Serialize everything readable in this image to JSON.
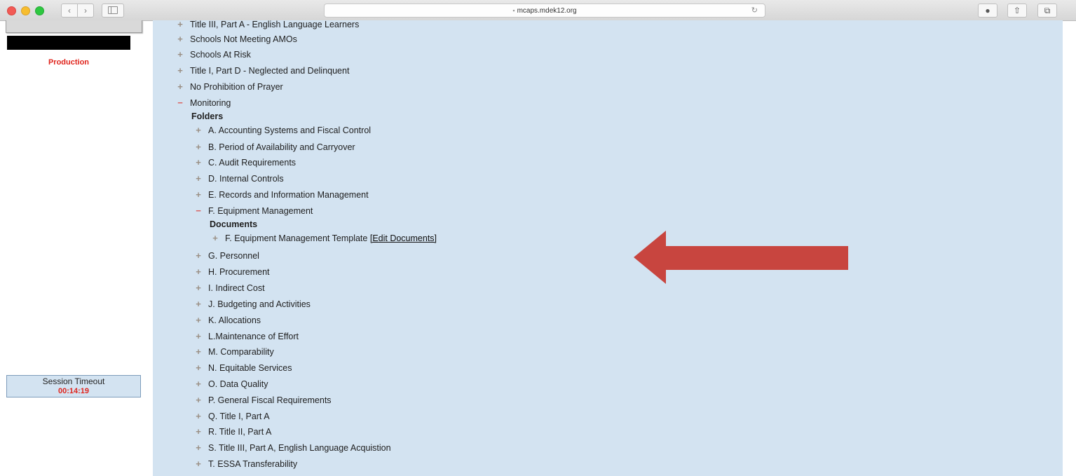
{
  "browser": {
    "url": "mcaps.mdek12.org",
    "back_glyph": "‹",
    "forward_glyph": "›",
    "reload_glyph": "↻",
    "info_glyph": "●",
    "share_glyph": "⇧",
    "tabs_glyph": "⧉"
  },
  "sidebar": {
    "environment": "Production",
    "session_label": "Session Timeout",
    "session_time": "00:14:19"
  },
  "tree": {
    "top_items": [
      {
        "label": "Title III, Part A - English Language Learners",
        "state": "collapsed"
      },
      {
        "label": "Schools Not Meeting AMOs",
        "state": "collapsed"
      },
      {
        "label": "Schools At Risk",
        "state": "collapsed"
      },
      {
        "label": "Title I, Part D - Neglected and Delinquent",
        "state": "collapsed"
      },
      {
        "label": "No Prohibition of Prayer",
        "state": "collapsed"
      },
      {
        "label": "Monitoring",
        "state": "expanded"
      }
    ],
    "folders_heading": "Folders",
    "folders_before": [
      {
        "label": "A. Accounting Systems and Fiscal Control",
        "state": "collapsed"
      },
      {
        "label": "B. Period of Availability and Carryover",
        "state": "collapsed"
      },
      {
        "label": "C. Audit Requirements",
        "state": "collapsed"
      },
      {
        "label": "D. Internal Controls",
        "state": "collapsed"
      },
      {
        "label": "E. Records and Information Management",
        "state": "collapsed"
      },
      {
        "label": "F. Equipment Management",
        "state": "expanded"
      }
    ],
    "documents_heading": "Documents",
    "document": {
      "label": "F. Equipment Management Template",
      "edit_link": "[Edit Documents]"
    },
    "folders_after": [
      {
        "label": "G. Personnel",
        "state": "collapsed"
      },
      {
        "label": "H. Procurement",
        "state": "collapsed"
      },
      {
        "label": "I. Indirect Cost",
        "state": "collapsed"
      },
      {
        "label": "J. Budgeting and Activities",
        "state": "collapsed"
      },
      {
        "label": "K. Allocations",
        "state": "collapsed"
      },
      {
        "label": "L.Maintenance of Effort",
        "state": "collapsed"
      },
      {
        "label": "M. Comparability",
        "state": "collapsed"
      },
      {
        "label": "N. Equitable Services",
        "state": "collapsed"
      },
      {
        "label": "O. Data Quality",
        "state": "collapsed"
      },
      {
        "label": "P. General Fiscal Requirements",
        "state": "collapsed"
      },
      {
        "label": "Q. Title I, Part A",
        "state": "collapsed"
      },
      {
        "label": "R. Title II, Part A",
        "state": "collapsed"
      },
      {
        "label": "S. Title III, Part A, English Language Acquistion",
        "state": "collapsed"
      },
      {
        "label": "T. ESSA Transferability",
        "state": "collapsed"
      }
    ]
  },
  "icons": {
    "expand": "+",
    "collapse": "−"
  },
  "colors": {
    "panel_bg": "#d3e3f1",
    "arrow": "#c8453f",
    "environment": "#e0241c"
  }
}
